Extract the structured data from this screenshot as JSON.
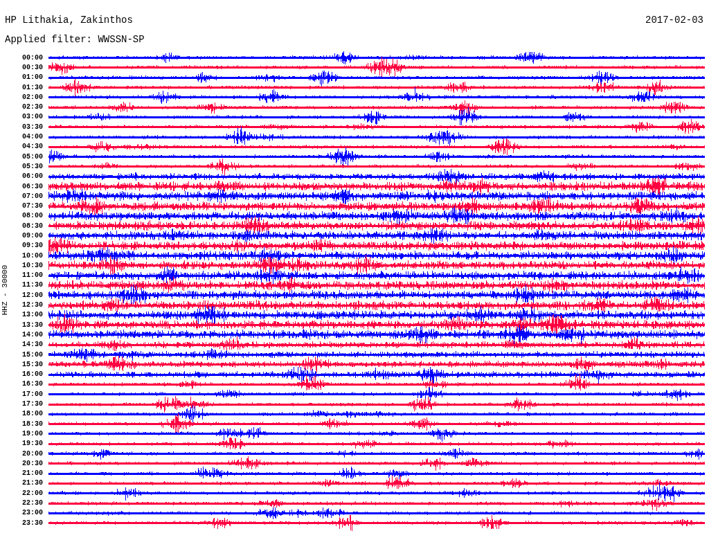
{
  "title": "HP Lithakia, Zakinthos",
  "date": "2017-02-03",
  "filter": "Applied filter: WWSSN-SP",
  "channel_label": "HHZ - 30000",
  "rows": [
    {
      "time": "00:00",
      "color": "#0000ff"
    },
    {
      "time": "00:30",
      "color": "#ff0040"
    },
    {
      "time": "01:00",
      "color": "#0000ff"
    },
    {
      "time": "01:30",
      "color": "#ff0040"
    },
    {
      "time": "02:00",
      "color": "#0000ff"
    },
    {
      "time": "02:30",
      "color": "#ff0040"
    },
    {
      "time": "03:00",
      "color": "#0000ff"
    },
    {
      "time": "03:30",
      "color": "#ff0040"
    },
    {
      "time": "04:00",
      "color": "#0000ff"
    },
    {
      "time": "04:30",
      "color": "#ff0040"
    },
    {
      "time": "05:00",
      "color": "#0000ff"
    },
    {
      "time": "05:30",
      "color": "#ff0040"
    },
    {
      "time": "06:00",
      "color": "#0000ff"
    },
    {
      "time": "06:30",
      "color": "#ff0040"
    },
    {
      "time": "07:00",
      "color": "#0000ff"
    },
    {
      "time": "07:30",
      "color": "#ff0040"
    },
    {
      "time": "08:00",
      "color": "#0000ff"
    },
    {
      "time": "08:30",
      "color": "#ff0040"
    },
    {
      "time": "09:00",
      "color": "#0000ff"
    },
    {
      "time": "09:30",
      "color": "#ff0040"
    },
    {
      "time": "10:00",
      "color": "#0000ff"
    },
    {
      "time": "10:30",
      "color": "#ff0040"
    },
    {
      "time": "11:00",
      "color": "#0000ff"
    },
    {
      "time": "11:30",
      "color": "#ff0040"
    },
    {
      "time": "12:00",
      "color": "#0000ff"
    },
    {
      "time": "12:30",
      "color": "#ff0040"
    },
    {
      "time": "13:00",
      "color": "#0000ff"
    },
    {
      "time": "13:30",
      "color": "#ff0040"
    },
    {
      "time": "14:00",
      "color": "#0000ff"
    },
    {
      "time": "14:30",
      "color": "#ff0040"
    },
    {
      "time": "15:00",
      "color": "#0000ff"
    },
    {
      "time": "15:30",
      "color": "#ff0040"
    },
    {
      "time": "16:00",
      "color": "#0000ff"
    },
    {
      "time": "16:30",
      "color": "#ff0040"
    },
    {
      "time": "17:00",
      "color": "#0000ff"
    },
    {
      "time": "17:30",
      "color": "#ff0040"
    },
    {
      "time": "18:00",
      "color": "#0000ff"
    },
    {
      "time": "18:30",
      "color": "#ff0040"
    },
    {
      "time": "19:00",
      "color": "#0000ff"
    },
    {
      "time": "19:30",
      "color": "#ff0040"
    },
    {
      "time": "20:00",
      "color": "#0000ff"
    },
    {
      "time": "20:30",
      "color": "#ff0040"
    },
    {
      "time": "21:00",
      "color": "#0000ff"
    },
    {
      "time": "21:30",
      "color": "#ff0040"
    },
    {
      "time": "22:00",
      "color": "#0000ff"
    },
    {
      "time": "22:30",
      "color": "#ff0040"
    },
    {
      "time": "23:00",
      "color": "#0000ff"
    },
    {
      "time": "23:30",
      "color": "#ff0040"
    }
  ]
}
